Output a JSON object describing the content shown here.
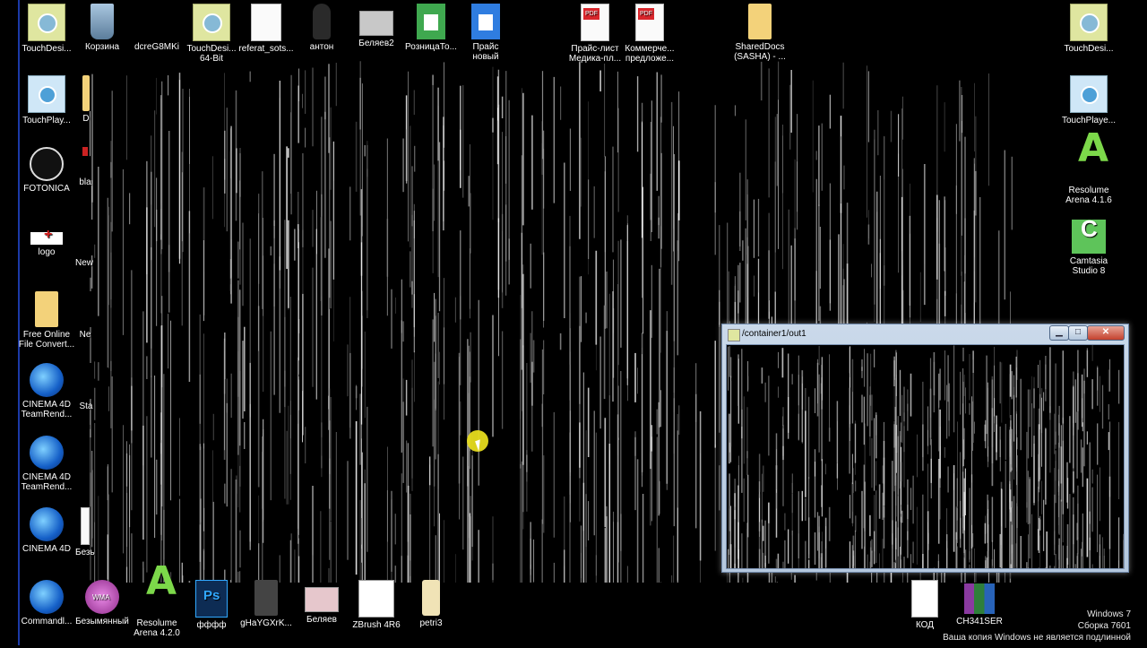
{
  "desktop_icons": {
    "touchdesigner": "TouchDesi...",
    "recycle_bin": "Корзина",
    "dcre": "dcreG8MKi",
    "touchdesigner_64": "TouchDesi...\n64-Bit",
    "referat": "referat_sots...",
    "anton": "антон",
    "belyaev2": "Беляев2",
    "roznica": "РозницаТо...",
    "price_new": "Прайс\nновый",
    "price_list_pdf": "Прайс-лист\nМедика-пл...",
    "commercial_pdf": "Коммерче...\nпредложе...",
    "shareddocs": "SharedDocs\n(SASHA) - ...",
    "touchdesigner_right": "TouchDesi...",
    "touchplayer": "TouchPlay...",
    "d_partial": "D",
    "touchplayer_right": "TouchPlaye...",
    "fotonica": "FOTONICA",
    "bla_partial": "bla",
    "resolume_416": "Resolume\nArena 4.1.6",
    "logo": "logo",
    "new_partial_1": "New",
    "camtasia": "Camtasia\nStudio 8",
    "free_online": "Free Online\nFile Convert...",
    "new_partial_2": "Ne",
    "cinema4d_teamrender_1": "CINEMA 4D\nTeamRend...",
    "sta_partial": "Sta",
    "cinema4d_teamrender_2": "CINEMA 4D\nTeamRend...",
    "cinema4d": "CINEMA 4D",
    "bez_partial": "Безы",
    "commandline": "Commandl...",
    "bezymyanny": "Безымянный",
    "resolume_420": "Resolume\nArena 4.2.0",
    "ffff": "фффф",
    "ghaygx": "gHaYGXrK...",
    "belyaev": "Беляев",
    "zbrush": "ZBrush 4R6",
    "petri3": "petri3",
    "kod": "КОД",
    "ch341ser": "CH341SER"
  },
  "output_window": {
    "title": "/container1/out1",
    "min_glyph": "▁",
    "max_glyph": "□",
    "close_glyph": "✕"
  },
  "watermark": {
    "line1": "Windows 7",
    "line2": "Сборка 7601",
    "line3": "Ваша копия Windows не является подлинной"
  },
  "colors": {
    "background": "#000000",
    "window_frame": "#b5c8de",
    "close_button": "#c4412d",
    "cursor_highlight": "#e7dc1e"
  }
}
